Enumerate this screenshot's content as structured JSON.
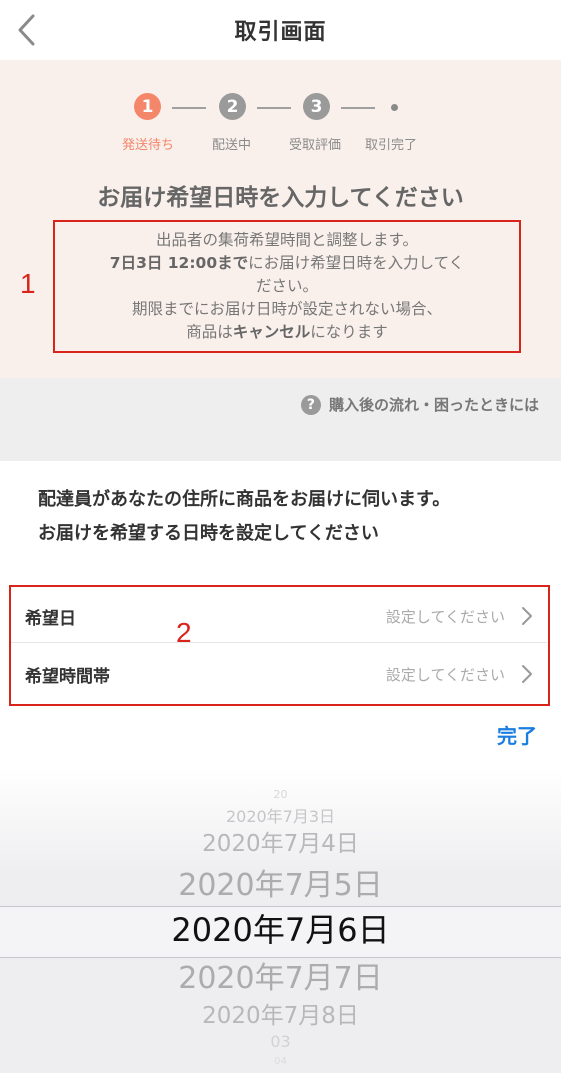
{
  "header": {
    "title": "取引画面"
  },
  "steps": [
    {
      "number": "1",
      "label": "発送待ち",
      "active": true
    },
    {
      "number": "2",
      "label": "配送中",
      "active": false
    },
    {
      "number": "3",
      "label": "受取評価",
      "active": false
    },
    {
      "number": "",
      "label": "取引完了",
      "active": false
    }
  ],
  "status": {
    "heading": "お届け希望日時を入力してください",
    "notice_line1": "出品者の集荷希望時間と調整します。",
    "notice_deadline": "7日3日 12:00まで",
    "notice_line2_rest": "にお届け希望日時を入力してく",
    "notice_line3": "ださい。",
    "notice_line4": "期限までにお届け日時が設定されない場合、",
    "notice_line5_pre": "商品は",
    "notice_line5_bold": "キャンセル",
    "notice_line5_post": "になります"
  },
  "annotations": {
    "box1": "1",
    "box2": "2"
  },
  "help": {
    "icon_text": "?",
    "link": "購入後の流れ・困ったときには"
  },
  "instructions": {
    "line1": "配達員があなたの住所に商品をお届けに伺います。",
    "line2": "お届けを希望する日時を設定してください"
  },
  "form": {
    "date_label": "希望日",
    "date_value": "設定してください",
    "time_label": "希望時間帯",
    "time_value": "設定してください"
  },
  "done_label": "完了",
  "picker": {
    "items": [
      "20",
      "2020年7月3日",
      "2020年7月4日",
      "2020年7月5日",
      "2020年7月6日",
      "2020年7月7日",
      "2020年7月8日",
      "03",
      "04"
    ],
    "selected": "2020年7月6日"
  },
  "colors": {
    "accent": "#f4866a",
    "annotation": "#d9241c",
    "link": "#1a7ee0",
    "panel": "#f9f0ec"
  },
  "icons": {
    "back": "chevron-left-icon",
    "help": "question-circle-icon",
    "row": "chevron-right-icon"
  }
}
